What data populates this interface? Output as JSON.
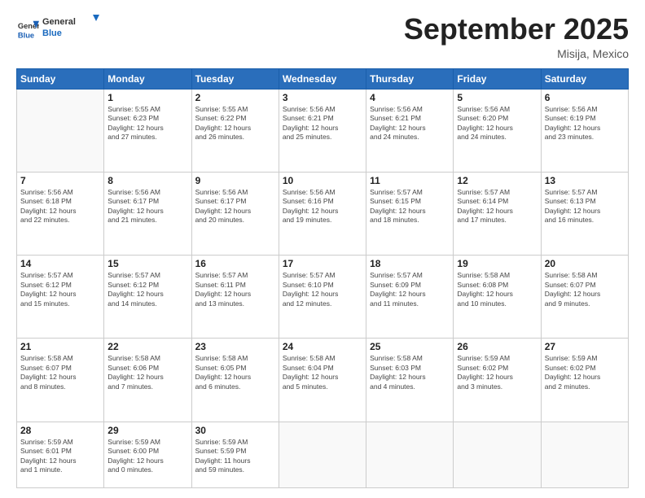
{
  "logo": {
    "general": "General",
    "blue": "Blue"
  },
  "header": {
    "month": "September 2025",
    "location": "Misija, Mexico"
  },
  "weekdays": [
    "Sunday",
    "Monday",
    "Tuesday",
    "Wednesday",
    "Thursday",
    "Friday",
    "Saturday"
  ],
  "weeks": [
    [
      {
        "day": "",
        "info": ""
      },
      {
        "day": "1",
        "info": "Sunrise: 5:55 AM\nSunset: 6:23 PM\nDaylight: 12 hours\nand 27 minutes."
      },
      {
        "day": "2",
        "info": "Sunrise: 5:55 AM\nSunset: 6:22 PM\nDaylight: 12 hours\nand 26 minutes."
      },
      {
        "day": "3",
        "info": "Sunrise: 5:56 AM\nSunset: 6:21 PM\nDaylight: 12 hours\nand 25 minutes."
      },
      {
        "day": "4",
        "info": "Sunrise: 5:56 AM\nSunset: 6:21 PM\nDaylight: 12 hours\nand 24 minutes."
      },
      {
        "day": "5",
        "info": "Sunrise: 5:56 AM\nSunset: 6:20 PM\nDaylight: 12 hours\nand 24 minutes."
      },
      {
        "day": "6",
        "info": "Sunrise: 5:56 AM\nSunset: 6:19 PM\nDaylight: 12 hours\nand 23 minutes."
      }
    ],
    [
      {
        "day": "7",
        "info": "Sunrise: 5:56 AM\nSunset: 6:18 PM\nDaylight: 12 hours\nand 22 minutes."
      },
      {
        "day": "8",
        "info": "Sunrise: 5:56 AM\nSunset: 6:17 PM\nDaylight: 12 hours\nand 21 minutes."
      },
      {
        "day": "9",
        "info": "Sunrise: 5:56 AM\nSunset: 6:17 PM\nDaylight: 12 hours\nand 20 minutes."
      },
      {
        "day": "10",
        "info": "Sunrise: 5:56 AM\nSunset: 6:16 PM\nDaylight: 12 hours\nand 19 minutes."
      },
      {
        "day": "11",
        "info": "Sunrise: 5:57 AM\nSunset: 6:15 PM\nDaylight: 12 hours\nand 18 minutes."
      },
      {
        "day": "12",
        "info": "Sunrise: 5:57 AM\nSunset: 6:14 PM\nDaylight: 12 hours\nand 17 minutes."
      },
      {
        "day": "13",
        "info": "Sunrise: 5:57 AM\nSunset: 6:13 PM\nDaylight: 12 hours\nand 16 minutes."
      }
    ],
    [
      {
        "day": "14",
        "info": "Sunrise: 5:57 AM\nSunset: 6:12 PM\nDaylight: 12 hours\nand 15 minutes."
      },
      {
        "day": "15",
        "info": "Sunrise: 5:57 AM\nSunset: 6:12 PM\nDaylight: 12 hours\nand 14 minutes."
      },
      {
        "day": "16",
        "info": "Sunrise: 5:57 AM\nSunset: 6:11 PM\nDaylight: 12 hours\nand 13 minutes."
      },
      {
        "day": "17",
        "info": "Sunrise: 5:57 AM\nSunset: 6:10 PM\nDaylight: 12 hours\nand 12 minutes."
      },
      {
        "day": "18",
        "info": "Sunrise: 5:57 AM\nSunset: 6:09 PM\nDaylight: 12 hours\nand 11 minutes."
      },
      {
        "day": "19",
        "info": "Sunrise: 5:58 AM\nSunset: 6:08 PM\nDaylight: 12 hours\nand 10 minutes."
      },
      {
        "day": "20",
        "info": "Sunrise: 5:58 AM\nSunset: 6:07 PM\nDaylight: 12 hours\nand 9 minutes."
      }
    ],
    [
      {
        "day": "21",
        "info": "Sunrise: 5:58 AM\nSunset: 6:07 PM\nDaylight: 12 hours\nand 8 minutes."
      },
      {
        "day": "22",
        "info": "Sunrise: 5:58 AM\nSunset: 6:06 PM\nDaylight: 12 hours\nand 7 minutes."
      },
      {
        "day": "23",
        "info": "Sunrise: 5:58 AM\nSunset: 6:05 PM\nDaylight: 12 hours\nand 6 minutes."
      },
      {
        "day": "24",
        "info": "Sunrise: 5:58 AM\nSunset: 6:04 PM\nDaylight: 12 hours\nand 5 minutes."
      },
      {
        "day": "25",
        "info": "Sunrise: 5:58 AM\nSunset: 6:03 PM\nDaylight: 12 hours\nand 4 minutes."
      },
      {
        "day": "26",
        "info": "Sunrise: 5:59 AM\nSunset: 6:02 PM\nDaylight: 12 hours\nand 3 minutes."
      },
      {
        "day": "27",
        "info": "Sunrise: 5:59 AM\nSunset: 6:02 PM\nDaylight: 12 hours\nand 2 minutes."
      }
    ],
    [
      {
        "day": "28",
        "info": "Sunrise: 5:59 AM\nSunset: 6:01 PM\nDaylight: 12 hours\nand 1 minute."
      },
      {
        "day": "29",
        "info": "Sunrise: 5:59 AM\nSunset: 6:00 PM\nDaylight: 12 hours\nand 0 minutes."
      },
      {
        "day": "30",
        "info": "Sunrise: 5:59 AM\nSunset: 5:59 PM\nDaylight: 11 hours\nand 59 minutes."
      },
      {
        "day": "",
        "info": ""
      },
      {
        "day": "",
        "info": ""
      },
      {
        "day": "",
        "info": ""
      },
      {
        "day": "",
        "info": ""
      }
    ]
  ]
}
